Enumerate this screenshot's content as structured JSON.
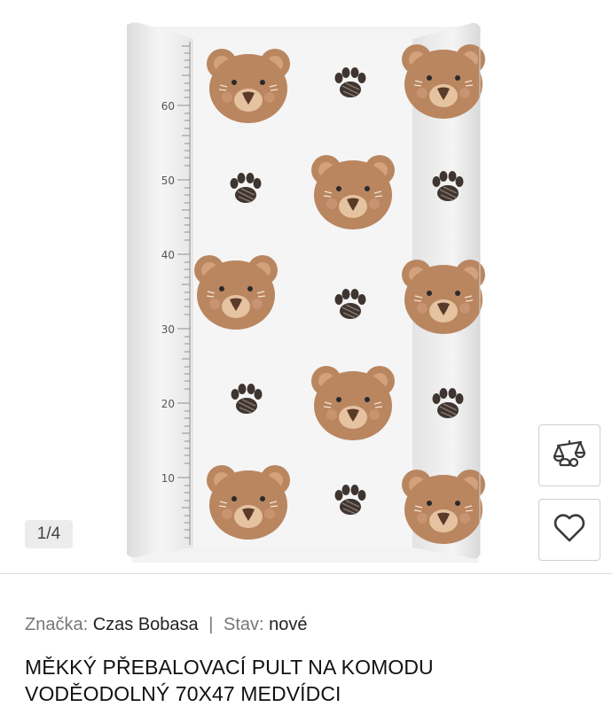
{
  "gallery": {
    "counter": "1/4",
    "ruler_labels": [
      "60",
      "50",
      "40",
      "30",
      "20",
      "10"
    ]
  },
  "product": {
    "brand_label": "Značka:",
    "brand": "Czas Bobasa",
    "separator": "|",
    "condition_label": "Stav:",
    "condition": "nové",
    "title": "MĚKKÝ PŘEBALOVACÍ PULT NA KOMODU VODĚODOLNÝ 70x47 MEDVÍDCI"
  },
  "icons": {
    "compare": "scale-compare-icon",
    "wishlist": "heart-icon"
  },
  "colors": {
    "bear_fur": "#b98660",
    "bear_ear_inner": "#d3a27c",
    "bear_muzzle": "#e5c2a0",
    "paw": "#3f3530",
    "mat": "#f3f3f3"
  }
}
